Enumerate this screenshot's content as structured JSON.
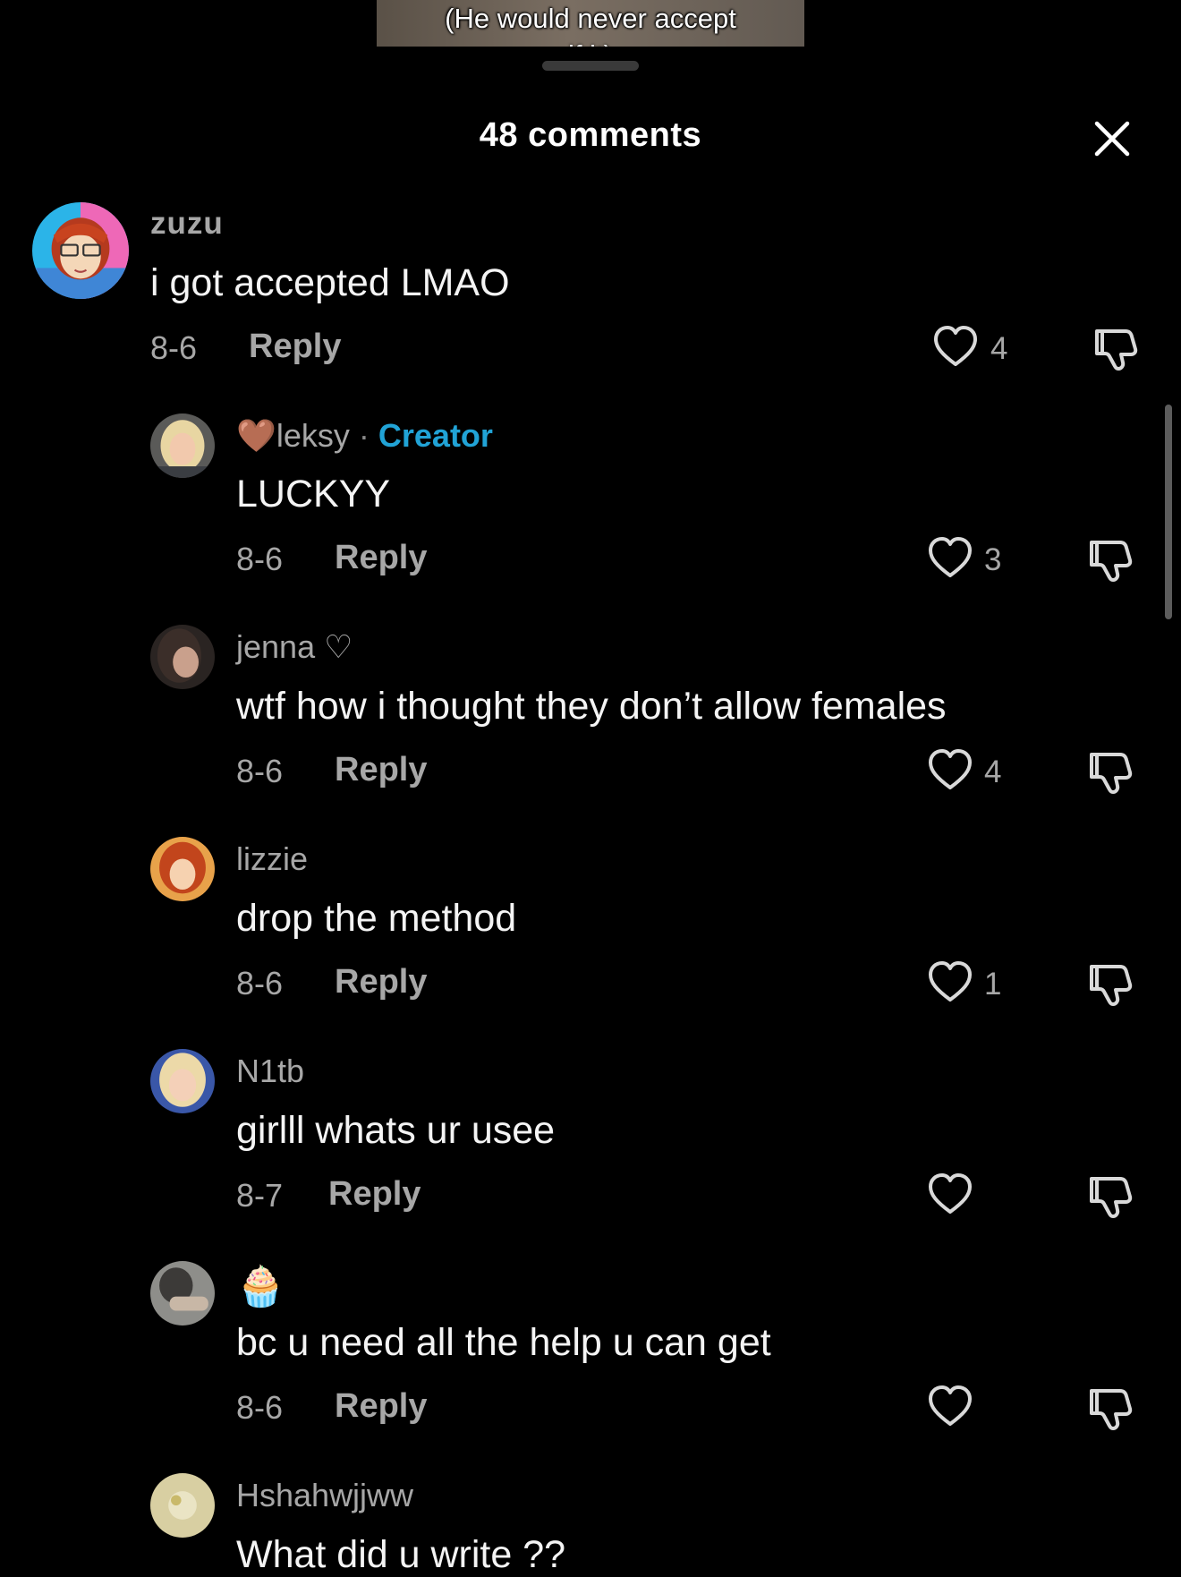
{
  "video": {
    "caption": "(He would never accept",
    "caption_clipped": "if                   it)"
  },
  "sheet": {
    "title": "48 comments"
  },
  "colors": {
    "background": "#000000",
    "creator_accent": "#21a3d6",
    "muted": "#a7a7a7"
  },
  "comments": [
    {
      "username": "zuzu",
      "text": "i got accepted LMAO",
      "date": "8-6",
      "reply_label": "Reply",
      "likes": "4"
    },
    {
      "username_prefix_emoji": "🤎",
      "username": "leksy",
      "separator": "·",
      "creator_label": "Creator",
      "text": "LUCKYY",
      "date": "8-6",
      "reply_label": "Reply",
      "likes": "3"
    },
    {
      "username": "jenna ♡",
      "text": "wtf how i thought they don’t allow females",
      "date": "8-6",
      "reply_label": "Reply",
      "likes": "4"
    },
    {
      "username": "lizzie",
      "text": "drop the method",
      "date": "8-6",
      "reply_label": "Reply",
      "likes": "1"
    },
    {
      "username": "N1tb",
      "text": "girlll whats ur usee",
      "date": "8-7",
      "reply_label": "Reply",
      "likes": ""
    },
    {
      "username": "🧁",
      "text": "bc u need all the help u can get",
      "date": "8-6",
      "reply_label": "Reply",
      "likes": ""
    },
    {
      "username": "Hshahwjjww",
      "text": "What did u write ??",
      "date": "",
      "reply_label": "",
      "likes": ""
    }
  ],
  "icons": {
    "close": "close-icon",
    "like": "heart-outline-icon",
    "dislike": "thumbs-down-icon"
  }
}
